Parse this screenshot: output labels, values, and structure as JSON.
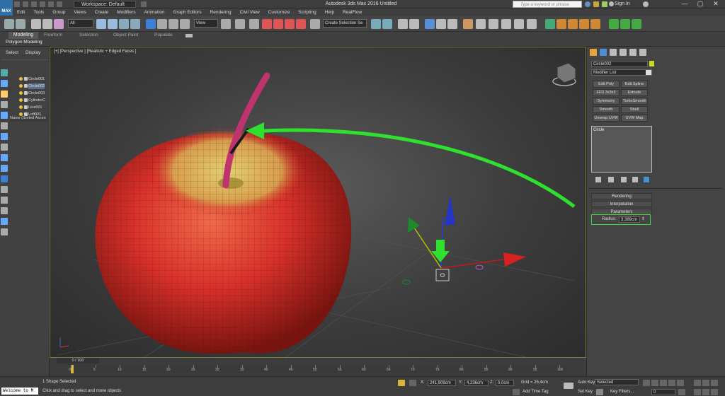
{
  "window": {
    "app_icon": "MAX",
    "title": "Autodesk 3ds Max 2016    Untitled",
    "workspace": "Workspace: Default",
    "search_placeholder": "Type a keyword or phrase",
    "sign_in": "Sign In",
    "controls": [
      "—",
      "▢",
      "✕"
    ]
  },
  "menu": [
    "Edit",
    "Tools",
    "Group",
    "Views",
    "Create",
    "Modifiers",
    "Animation",
    "Graph Editors",
    "Rendering",
    "Civil View",
    "Customize",
    "Scripting",
    "Help",
    "RealFlow"
  ],
  "toolbar": {
    "selection_filter": "All",
    "ref_coord": "View",
    "named_selection": "Create Selection Se"
  },
  "ribbon": {
    "tabs": [
      "Modeling",
      "Freeform",
      "Selection",
      "Object Paint",
      "Populate"
    ],
    "panel": "Polygon Modeling"
  },
  "explorer": {
    "tabs": [
      "Select",
      "Display"
    ],
    "header": "Name (Sorted Ascen",
    "items": [
      {
        "name": "Circle001",
        "selected": false
      },
      {
        "name": "Circle002",
        "selected": true
      },
      {
        "name": "Circle003",
        "selected": false
      },
      {
        "name": "CylinderC",
        "selected": false
      },
      {
        "name": "Line001",
        "selected": false
      },
      {
        "name": "Loft001",
        "selected": false
      }
    ]
  },
  "viewport": {
    "label": "[+] [Perspective ] [Realistic + Edged Faces ]"
  },
  "command_panel": {
    "object_name": "Circle002",
    "object_color": "#cbd82a",
    "modifier_list": "Modifier List",
    "modifier_buttons": [
      "Edit Poly",
      "Edit Spline",
      "FFD 3x3x3",
      "Extrude",
      "Symmetry",
      "TurboSmooth",
      "Smooth",
      "Shell",
      "Unwrap UVW",
      "UVW Map"
    ],
    "stack_item": "Circle",
    "rollouts": [
      "Rendering",
      "Interpolation",
      "Parameters"
    ],
    "radius_label": "Radius:",
    "radius_value": "3,389cm"
  },
  "timeline": {
    "frame": "0 / 100",
    "ticks": [
      "0",
      "5",
      "10",
      "15",
      "20",
      "25",
      "30",
      "35",
      "40",
      "45",
      "50",
      "55",
      "60",
      "65",
      "70",
      "75",
      "80",
      "85",
      "90",
      "95",
      "100"
    ]
  },
  "status": {
    "welcome": "Welcome to M",
    "selection": "1 Shape Selected",
    "prompt": "Click and drag to select and move objects",
    "x_label": "X:",
    "x_value": "241,909cm",
    "y_label": "Y:",
    "y_value": "4,236cm",
    "z_label": "Z:",
    "z_value": "0,0cm",
    "grid": "Grid = 25,4cm",
    "add_time_tag": "Add Time Tag",
    "auto_key": "Auto Key",
    "key_mode": "Selected",
    "set_key": "Set Key",
    "key_filters": "Key Filters...",
    "current_frame": "0"
  },
  "colors": {
    "accent_green": "#2fe02f",
    "apple_red": "#d8312a",
    "stem": "#c0346e"
  }
}
